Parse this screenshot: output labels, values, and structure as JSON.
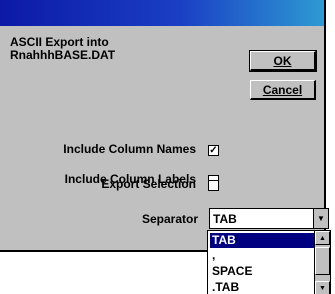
{
  "dialog": {
    "message_line1": "ASCII Export into",
    "message_line2": "RnahhhBASE.DAT",
    "ok_label": "OK",
    "cancel_label": "Cancel"
  },
  "options": {
    "include_column_names": {
      "label": "Include Column Names",
      "checked": true
    },
    "include_column_labels": {
      "label": "Include Column Labels",
      "checked": false
    },
    "export_selection": {
      "label": "Export Selection",
      "checked": false
    }
  },
  "separator": {
    "label": "Separator",
    "value": "TAB",
    "options": [
      "TAB",
      ",",
      "SPACE",
      ".TAB"
    ],
    "selected_index": 0
  },
  "icons": {
    "check": "✓",
    "dropdown": "▼",
    "scroll_up": "▲",
    "scroll_down": "▼"
  },
  "colors": {
    "title_bar_start": "#0c1aa6",
    "title_bar_end": "#2e9ad2",
    "selection": "#000080",
    "face": "#c0c0c0"
  }
}
